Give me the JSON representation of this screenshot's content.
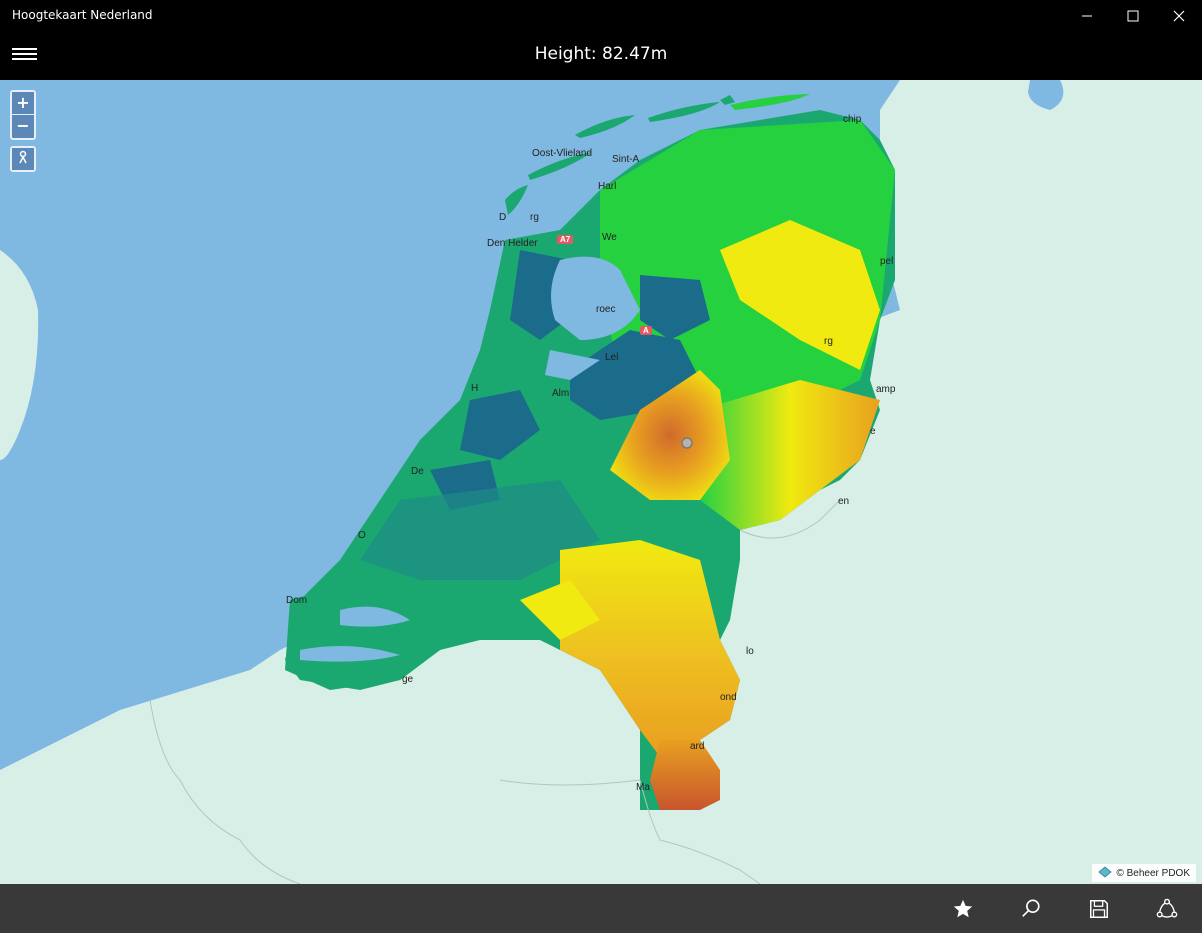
{
  "window": {
    "title": "Hoogtekaart Nederland",
    "controls": [
      "minimize-icon",
      "maximize-icon",
      "close-icon"
    ]
  },
  "header": {
    "menu_icon": "hamburger-icon",
    "title": "Height: 82.47m"
  },
  "map": {
    "zoom_in_label": "+",
    "zoom_out_label": "−",
    "location_icon": "person-pin-icon",
    "place_labels": [
      "Oost-Vlieland",
      "Sint-A",
      "Harl",
      "D",
      "rg",
      "Den Helder",
      "We",
      "roec",
      "Lel",
      "Alm",
      "H",
      "De",
      "O",
      "Dom",
      "ge",
      "chip",
      "pel",
      "rg",
      "amp",
      "e",
      "en",
      "lo",
      "ond",
      "ard",
      "Ma"
    ],
    "road_shields": [
      "A7",
      "A"
    ],
    "marker_icon": "location-marker-icon",
    "attribution_icon": "layers-icon",
    "attribution": "© Beheer PDOK",
    "colors": {
      "sea": "#7fb8e0",
      "land": "#d8efe8",
      "low": "#1b6b8a",
      "mid": "#1aa870",
      "high_green": "#26d140",
      "yellow": "#f0ea10",
      "orange": "#e8a020",
      "red": "#c8552e"
    }
  },
  "bottombar": {
    "buttons": [
      {
        "name": "favorites-button",
        "icon": "star-icon"
      },
      {
        "name": "search-button",
        "icon": "search-icon"
      },
      {
        "name": "save-button",
        "icon": "save-icon"
      },
      {
        "name": "share-button",
        "icon": "share-icon"
      }
    ]
  }
}
